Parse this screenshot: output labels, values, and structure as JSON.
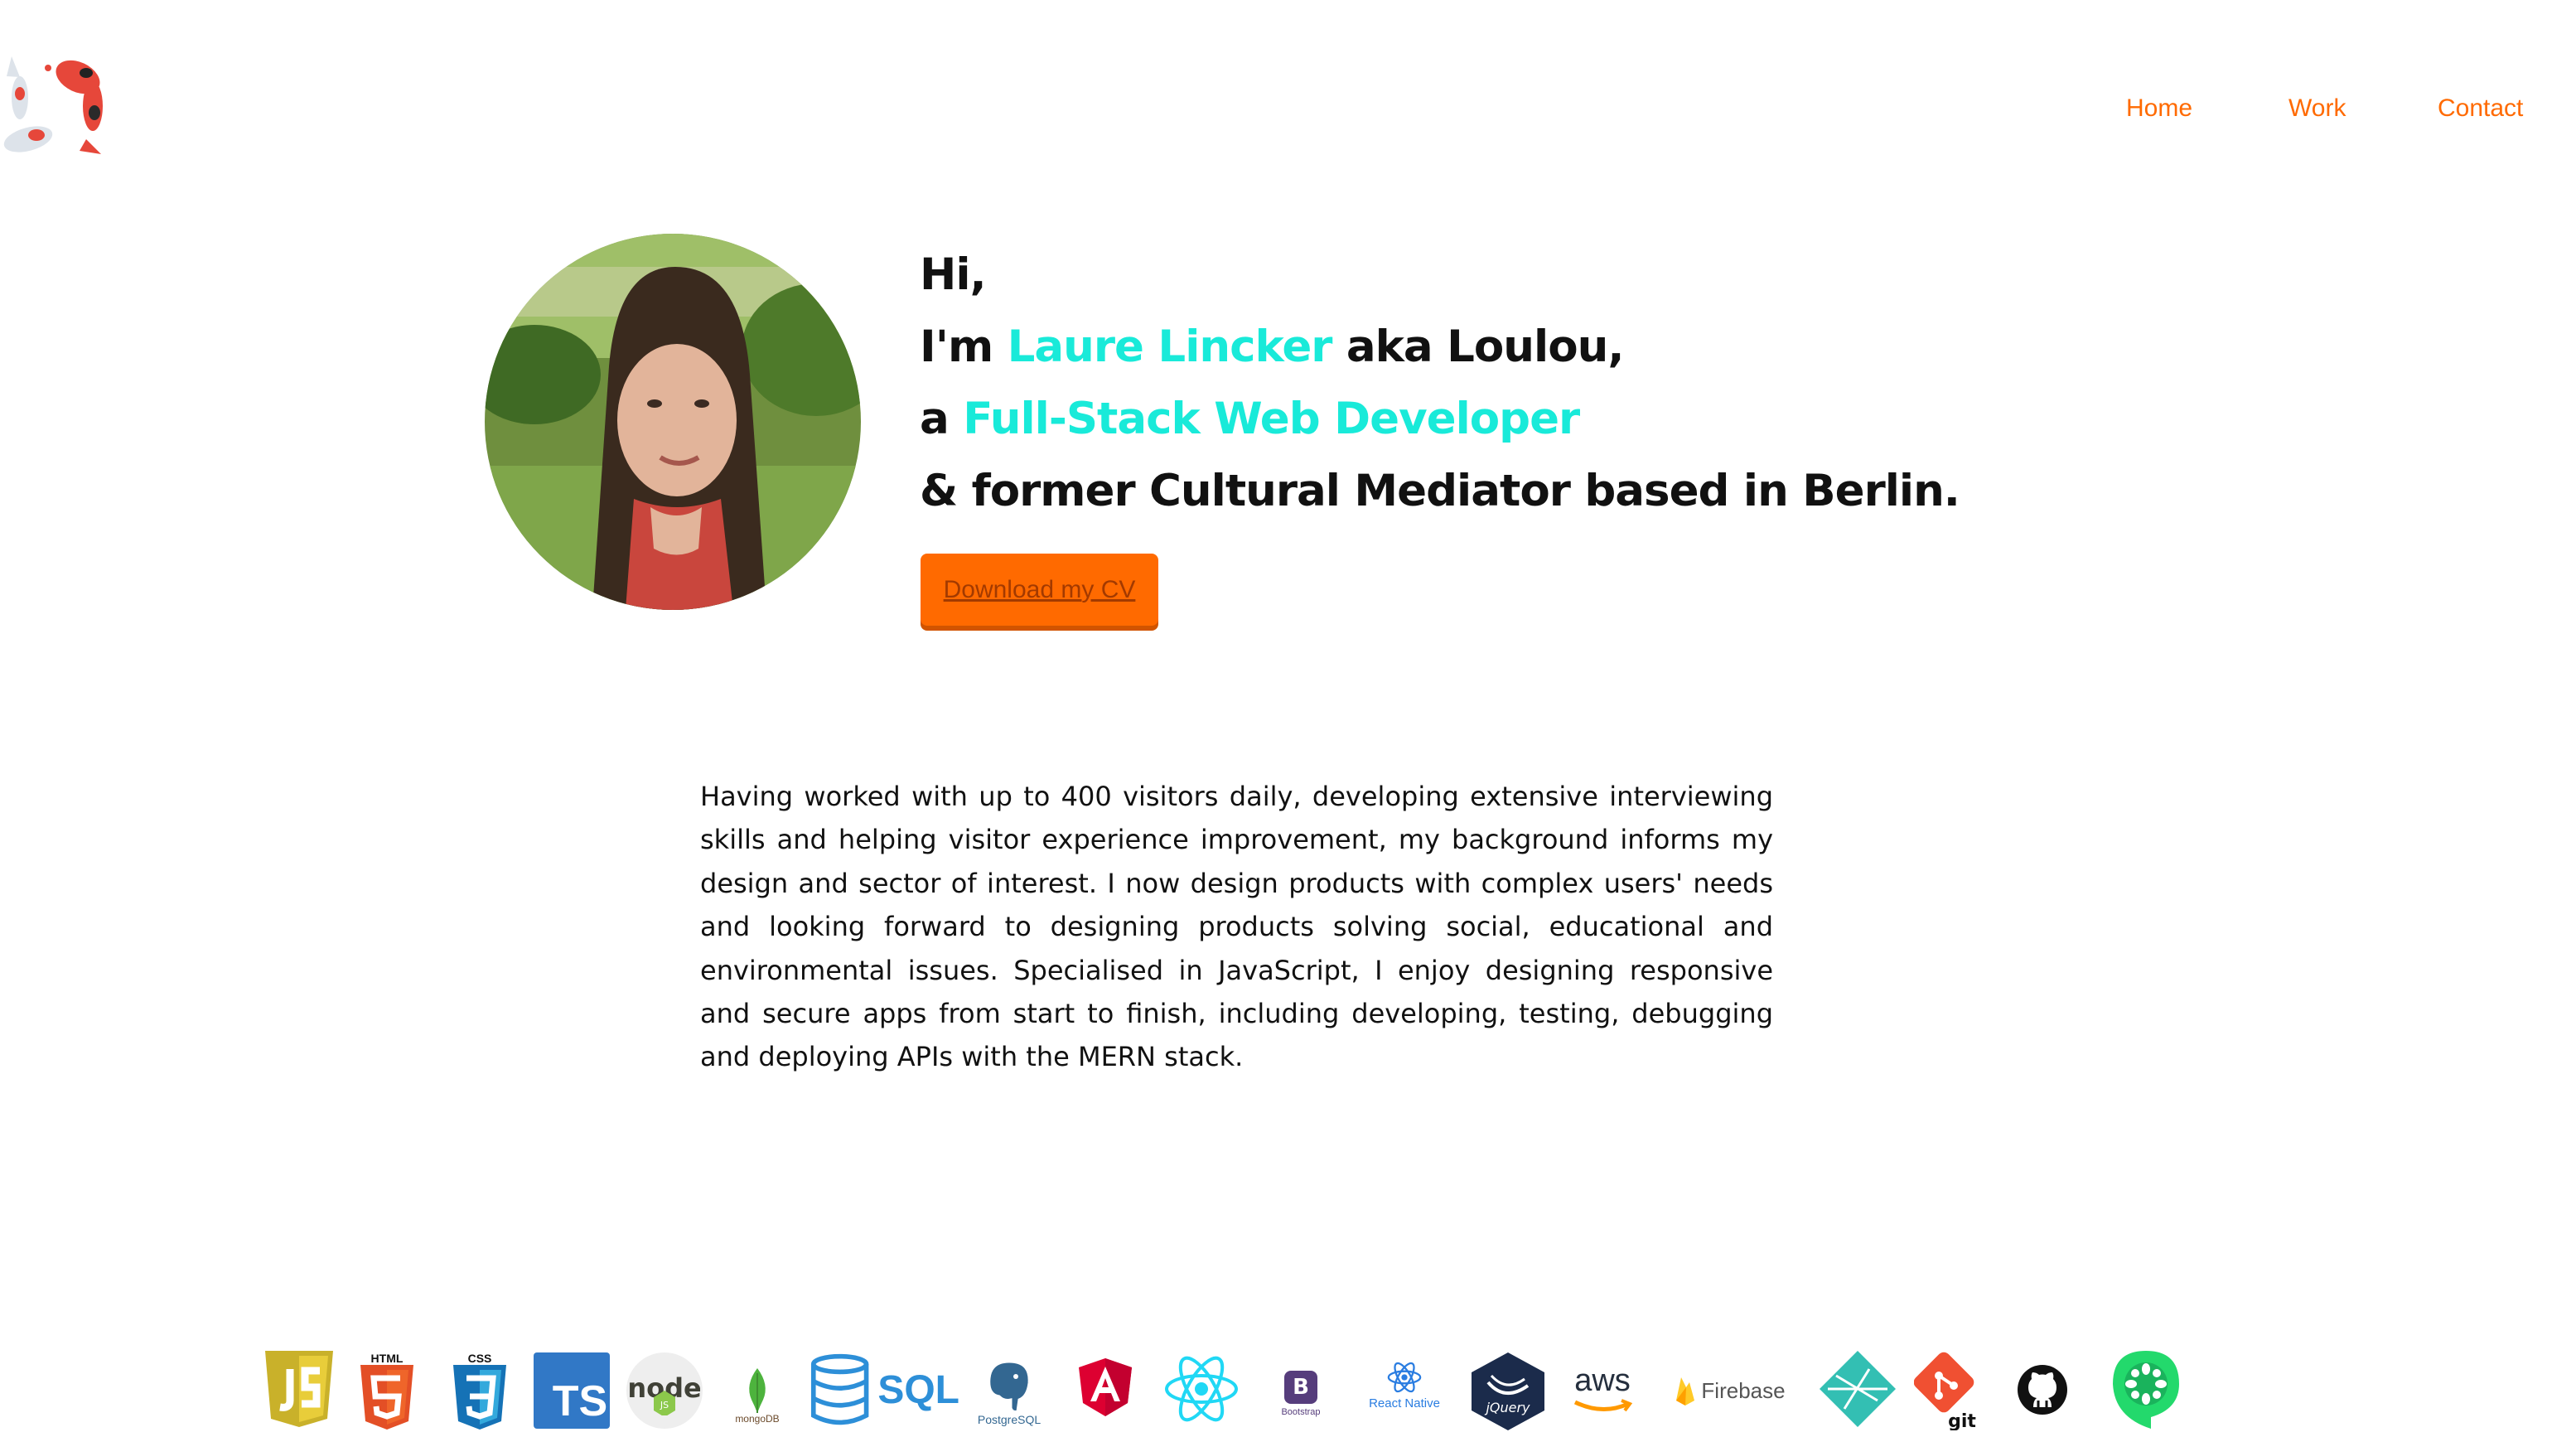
{
  "nav": {
    "home": "Home",
    "work": "Work",
    "contact": "Contact"
  },
  "hero": {
    "line1": "Hi,",
    "line2_prefix": "I'm ",
    "name": "Laure Lincker",
    "line2_suffix": " aka Loulou,",
    "line3_prefix": "a ",
    "role": "Full-Stack Web Developer",
    "line4": "& former Cultural Mediator based in Berlin."
  },
  "cv_button": "Download my CV",
  "bio": "Having worked with up to 400 visitors daily, developing extensive interviewing skills and helping visitor experience improvement, my background informs my design and sector of interest. I now design products with complex users' needs and looking forward to designing products solving social, educational and environmental issues. Specialised in JavaScript, I enjoy designing responsive and secure apps from start to finish, including developing, testing, debugging and deploying APIs with the MERN stack.",
  "tech": {
    "html_label": "HTML",
    "css_label": "CSS",
    "ts_label": "TS",
    "mongodb_label": "mongoDB",
    "sql_label": "SQL",
    "postgres_label": "PostgreSQL",
    "bootstrap_label": "Bootstrap",
    "react_native_label": "React Native",
    "jquery_label": "jQuery",
    "aws_label": "aws",
    "firebase_label": "Firebase",
    "git_label": "git"
  },
  "colors": {
    "accent_orange": "#ff6a00",
    "accent_teal": "#19ead9",
    "text": "#111111"
  },
  "icons": [
    "koi-fish-logo",
    "javascript-icon",
    "html5-icon",
    "css3-icon",
    "typescript-icon",
    "nodejs-icon",
    "mongodb-icon",
    "sql-icon",
    "postgresql-icon",
    "angular-icon",
    "react-icon",
    "bootstrap-icon",
    "react-native-icon",
    "jquery-icon",
    "aws-icon",
    "firebase-icon",
    "netlify-icon",
    "git-icon",
    "github-icon",
    "cucumber-icon"
  ]
}
